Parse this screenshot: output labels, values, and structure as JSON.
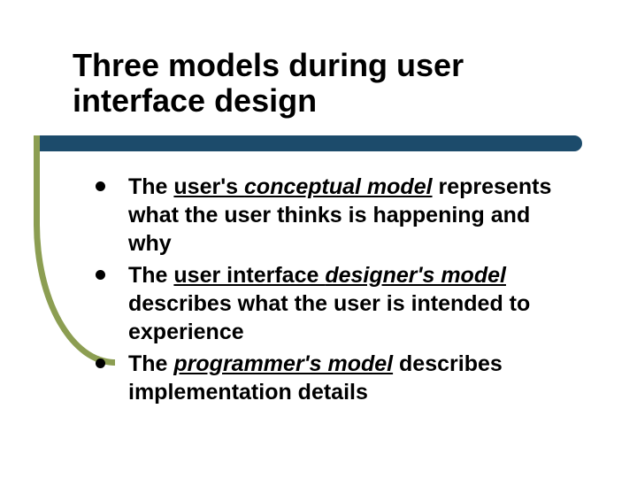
{
  "title": "Three models during user interface design",
  "bullets": [
    {
      "pre": "The ",
      "u_a": "user's ",
      "u_em": "conceptual model",
      "post": " represents what the user thinks is happening and why"
    },
    {
      "pre": "The ",
      "u_a": "user interface ",
      "u_em": "designer's model",
      "post": " describes what the user is intended to experience"
    },
    {
      "pre": "The ",
      "u_a": "",
      "u_em": "programmer's model",
      "post": " describes implementation details"
    }
  ]
}
